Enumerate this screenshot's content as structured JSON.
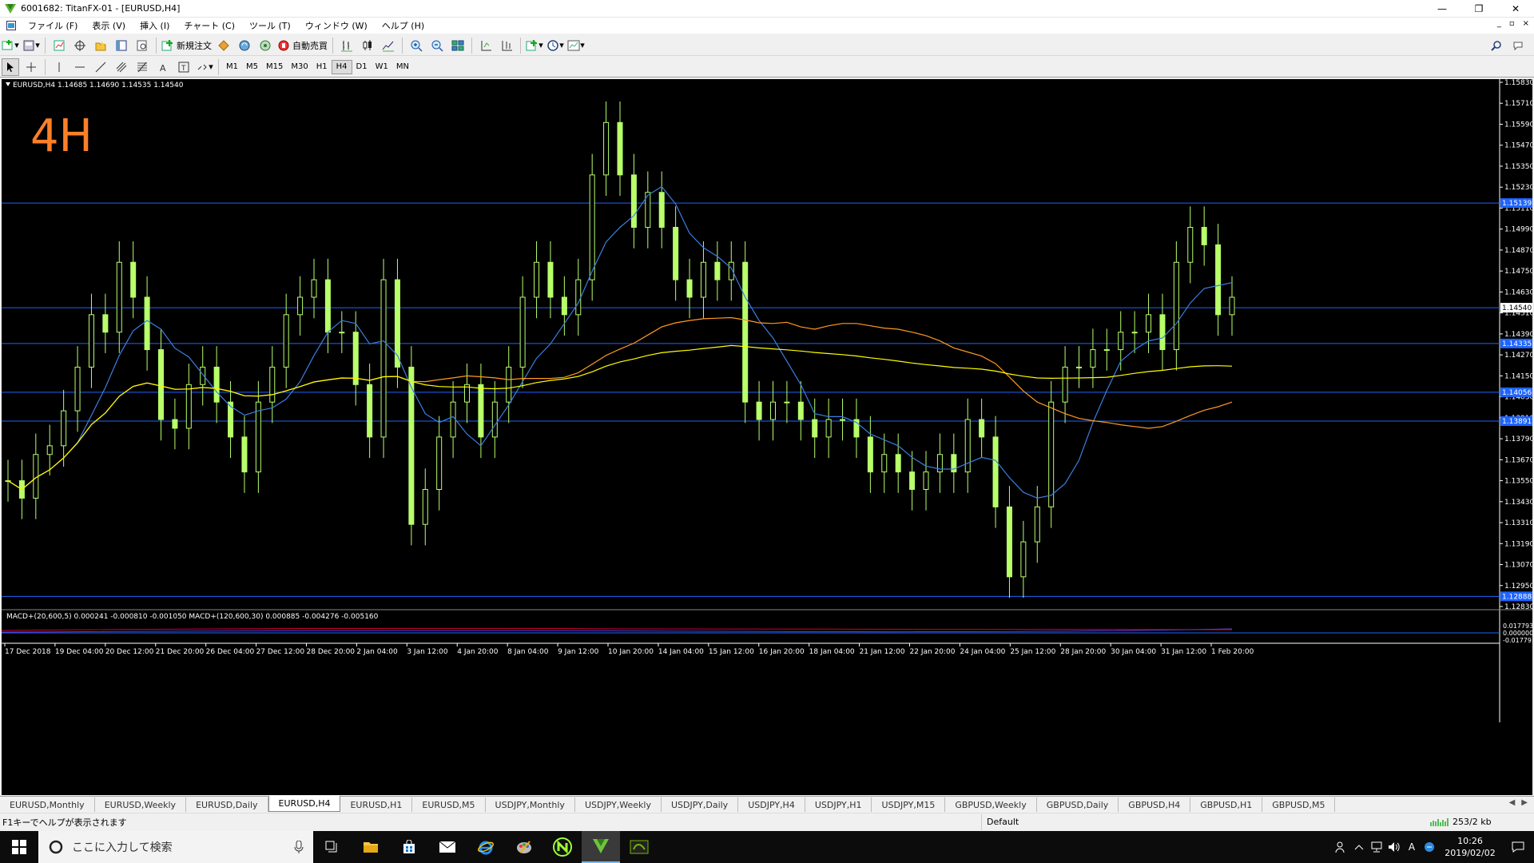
{
  "window": {
    "title": "6001682: TitanFX-01 - [EURUSD,H4]",
    "min": "—",
    "restore": "❐",
    "close": "✕"
  },
  "menu": {
    "items": [
      "ファイル (F)",
      "表示 (V)",
      "挿入 (I)",
      "チャート (C)",
      "ツール (T)",
      "ウィンドウ (W)",
      "ヘルプ (H)"
    ],
    "mdi_controls": [
      "_",
      "▫",
      "×"
    ]
  },
  "toolbar": {
    "new_order": "新規注文",
    "auto_trading": "自動売買"
  },
  "timeframes": [
    "M1",
    "M5",
    "M15",
    "M30",
    "H1",
    "H4",
    "D1",
    "W1",
    "MN"
  ],
  "active_timeframe": "H4",
  "chart": {
    "header": "EURUSD,H4  1.14685 1.14690 1.14535 1.14540",
    "big_label": "4H",
    "price_labels": [
      "1.15830",
      "1.15710",
      "1.15590",
      "1.15470",
      "1.15350",
      "1.15230",
      "1.15110",
      "1.14990",
      "1.14870",
      "1.14750",
      "1.14630",
      "1.14510",
      "1.14390",
      "1.14270",
      "1.14150",
      "1.14030",
      "1.13910",
      "1.13790",
      "1.13670",
      "1.13550",
      "1.13430",
      "1.13310",
      "1.13190",
      "1.13070",
      "1.12950",
      "1.12830"
    ],
    "hlines": [
      {
        "price": 1.15139,
        "label": "1.15139"
      },
      {
        "price": 1.1454,
        "label": "1.14540",
        "current": true
      },
      {
        "price": 1.14335,
        "label": "1.14335"
      },
      {
        "price": 1.14056,
        "label": "1.14056"
      },
      {
        "price": 1.13891,
        "label": "1.13891"
      },
      {
        "price": 1.12888,
        "label": "1.12888"
      }
    ],
    "date_labels": [
      "17 Dec 2018",
      "19 Dec 04:00",
      "20 Dec 12:00",
      "21 Dec 20:00",
      "26 Dec 04:00",
      "27 Dec 12:00",
      "28 Dec 20:00",
      "2 Jan 04:00",
      "3 Jan 12:00",
      "4 Jan 20:00",
      "8 Jan 04:00",
      "9 Jan 12:00",
      "10 Jan 20:00",
      "14 Jan 04:00",
      "15 Jan 12:00",
      "16 Jan 20:00",
      "18 Jan 04:00",
      "21 Jan 12:00",
      "22 Jan 20:00",
      "24 Jan 04:00",
      "25 Jan 12:00",
      "28 Jan 20:00",
      "30 Jan 04:00",
      "31 Jan 12:00",
      "1 Feb 20:00"
    ],
    "macd_header": "MACD+(20,600,5) 0.000241 -0.000810 -0.001050  MACD+(120,600,30) 0.000885 -0.004276 -0.005160",
    "macd_labels": [
      "0.017793",
      "0.000000",
      "-0.017793"
    ],
    "colors": {
      "bg": "#000000",
      "candle": "#b8ff6a",
      "ma_fast": "#3a7fe0",
      "ma_slow": "#ffff00",
      "ma_mid": "#ff9a1f",
      "hline": "#1e64ff",
      "big_label": "#ff7f27"
    }
  },
  "chart_data": {
    "type": "line",
    "title": "EURUSD,H4",
    "ylim": [
      1.1283,
      1.1583
    ],
    "series": [
      {
        "name": "EURUSD",
        "values": [
          1.1355,
          1.1345,
          1.137,
          1.1375,
          1.1395,
          1.142,
          1.145,
          1.144,
          1.148,
          1.146,
          1.143,
          1.139,
          1.1385,
          1.141,
          1.142,
          1.14,
          1.138,
          1.136,
          1.14,
          1.142,
          1.145,
          1.146,
          1.147,
          1.144,
          1.144,
          1.141,
          1.138,
          1.147,
          1.142,
          1.133,
          1.135,
          1.138,
          1.14,
          1.141,
          1.138,
          1.14,
          1.142,
          1.146,
          1.148,
          1.146,
          1.145,
          1.147,
          1.153,
          1.156,
          1.153,
          1.15,
          1.152,
          1.15,
          1.147,
          1.146,
          1.148,
          1.147,
          1.148,
          1.14,
          1.139,
          1.14,
          1.14,
          1.139,
          1.138,
          1.139,
          1.139,
          1.138,
          1.136,
          1.137,
          1.136,
          1.135,
          1.136,
          1.137,
          1.136,
          1.139,
          1.138,
          1.134,
          1.13,
          1.132,
          1.134,
          1.14,
          1.142,
          1.142,
          1.143,
          1.143,
          1.144,
          1.144,
          1.145,
          1.143,
          1.148,
          1.15,
          1.149,
          1.145,
          1.146
        ]
      }
    ]
  },
  "tabs": [
    "EURUSD,Monthly",
    "EURUSD,Weekly",
    "EURUSD,Daily",
    "EURUSD,H4",
    "EURUSD,H1",
    "EURUSD,M5",
    "USDJPY,Monthly",
    "USDJPY,Weekly",
    "USDJPY,Daily",
    "USDJPY,H4",
    "USDJPY,H1",
    "USDJPY,M15",
    "GBPUSD,Weekly",
    "GBPUSD,Daily",
    "GBPUSD,H4",
    "GBPUSD,H1",
    "GBPUSD,M5"
  ],
  "active_tab": "EURUSD,H4",
  "status": {
    "hint": "F1キーでヘルプが表示されます",
    "profile": "Default",
    "traffic": "253/2 kb"
  },
  "taskbar": {
    "search_placeholder": "ここに入力して検索",
    "time": "10:26",
    "date": "2019/02/02",
    "ime": "A"
  }
}
